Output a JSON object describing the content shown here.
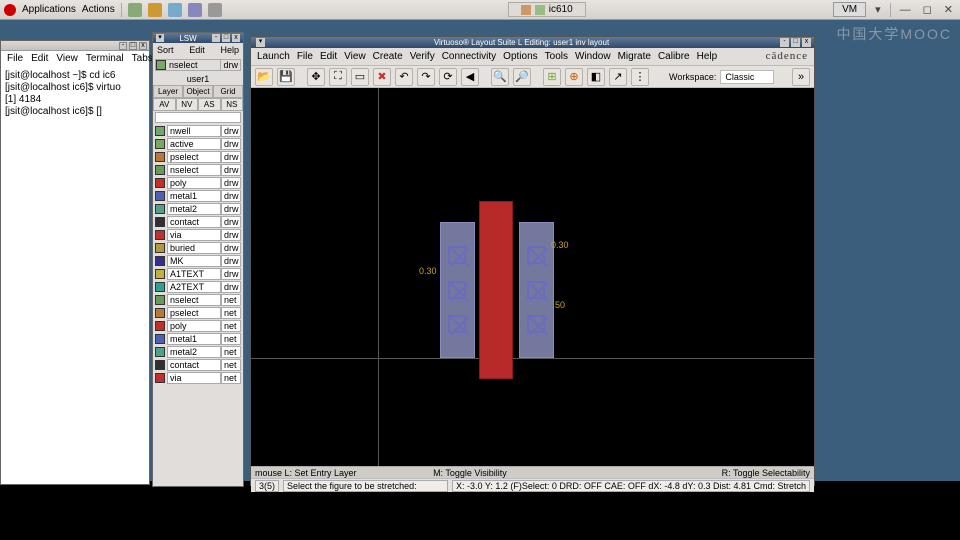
{
  "taskbar": {
    "apps_label": "Applications",
    "actions_label": "Actions",
    "task_entry": "ic610",
    "vm_label": "VM"
  },
  "watermark": "中国大学MOOC",
  "terminal": {
    "menu": [
      "File",
      "Edit",
      "View",
      "Terminal",
      "Tabs"
    ],
    "lines": [
      "[jsit@localhost ~]$ cd ic6",
      "[jsit@localhost ic6]$ virtuo",
      "[1] 4184",
      "[jsit@localhost ic6]$ []"
    ]
  },
  "lsw": {
    "title": "LSW",
    "menu": [
      "Sort",
      "Edit",
      "Help"
    ],
    "selected_layer": "nselect",
    "selected_purpose": "drw",
    "library": "user1",
    "tabs": [
      "Layer",
      "Object",
      "Grid"
    ],
    "buttons": [
      "AV",
      "NV",
      "AS",
      "NS"
    ],
    "layers": [
      {
        "name": "nwell",
        "purpose": "drw",
        "color": "#6ea870"
      },
      {
        "name": "active",
        "purpose": "drw",
        "color": "#7aa85e"
      },
      {
        "name": "pselect",
        "purpose": "drw",
        "color": "#b87838"
      },
      {
        "name": "nselect",
        "purpose": "drw",
        "color": "#6a9a5a"
      },
      {
        "name": "poly",
        "purpose": "drw",
        "color": "#c03028"
      },
      {
        "name": "metal1",
        "purpose": "drw",
        "color": "#5060b0"
      },
      {
        "name": "metal2",
        "purpose": "drw",
        "color": "#50a090"
      },
      {
        "name": "contact",
        "purpose": "drw",
        "color": "#303030"
      },
      {
        "name": "via",
        "purpose": "drw",
        "color": "#c03030"
      },
      {
        "name": "buried",
        "purpose": "drw",
        "color": "#b09a40"
      },
      {
        "name": "MK",
        "purpose": "drw",
        "color": "#303090"
      },
      {
        "name": "A1TEXT",
        "purpose": "drw",
        "color": "#c0b040"
      },
      {
        "name": "A2TEXT",
        "purpose": "drw",
        "color": "#30a090"
      },
      {
        "name": "nselect",
        "purpose": "net",
        "color": "#6a9a5a"
      },
      {
        "name": "pselect",
        "purpose": "net",
        "color": "#b87838"
      },
      {
        "name": "poly",
        "purpose": "net",
        "color": "#c03028"
      },
      {
        "name": "metal1",
        "purpose": "net",
        "color": "#5060b0"
      },
      {
        "name": "metal2",
        "purpose": "net",
        "color": "#50a090"
      },
      {
        "name": "contact",
        "purpose": "net",
        "color": "#303030"
      },
      {
        "name": "via",
        "purpose": "net",
        "color": "#c03030"
      }
    ]
  },
  "virtuoso": {
    "title": "Virtuoso® Layout Suite L Editing: user1 inv layout",
    "menu": [
      "Launch",
      "File",
      "Edit",
      "View",
      "Create",
      "Verify",
      "Connectivity",
      "Options",
      "Tools",
      "Window",
      "Migrate",
      "Calibre",
      "Help"
    ],
    "brand": "cādence",
    "workspace_label": "Workspace:",
    "workspace_value": "Classic",
    "dims": {
      "d1": "0.30",
      "d2": "0.30",
      "d3": "50"
    },
    "mouse_bar": {
      "left": "mouse L: Set Entry Layer",
      "mid": "M: Toggle Visibility",
      "right": "R: Toggle Selectability"
    },
    "status": {
      "sel": "3(5)",
      "prompt": "Select the figure to be stretched:",
      "info": "X: -3.0   Y: 1.2   (F)Select: 0   DRD: OFF   CAE: OFF   dX: -4.8   dY: 0.3   Dist: 4.81   Cmd: Stretch"
    }
  }
}
